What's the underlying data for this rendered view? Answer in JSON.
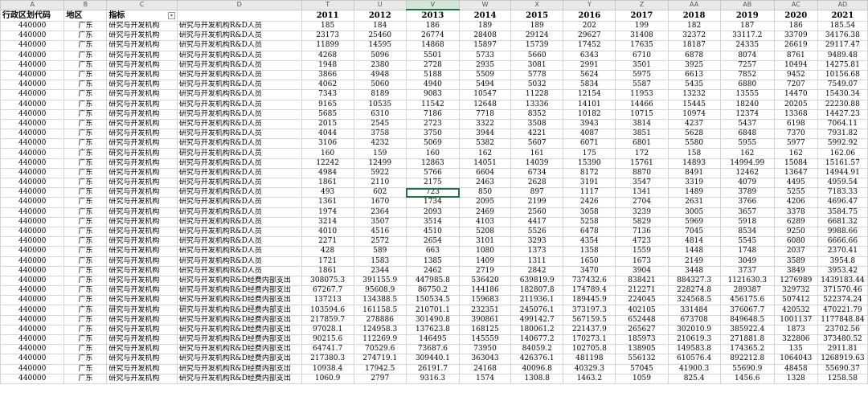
{
  "column_letters": [
    "A",
    "B",
    "C",
    "D",
    "T",
    "U",
    "V",
    "W",
    "X",
    "Y",
    "Z",
    "AA",
    "AB",
    "AC",
    "AD"
  ],
  "selected_column": "V",
  "header": [
    "行政区划代码",
    "地区",
    "指标",
    "",
    "2011",
    "2012",
    "2013",
    "2014",
    "2015",
    "2016",
    "2017",
    "2018",
    "2019",
    "2020",
    "2021"
  ],
  "code": "440000",
  "region": "广东",
  "rows": [
    [
      "研究与开发机构",
      "研究与开发机构R&D人员",
      "185",
      "184",
      "186",
      "189",
      "189",
      "202",
      "199",
      "182",
      "187",
      "186",
      "185.54"
    ],
    [
      "研究与开发机构",
      "研究与开发机构R&D人员",
      "23173",
      "25460",
      "26774",
      "28408",
      "29124",
      "29627",
      "31408",
      "32372",
      "33117.2",
      "33709",
      "34176.38"
    ],
    [
      "研究与开发机构",
      "研究与开发机构R&D人员",
      "11899",
      "14595",
      "14868",
      "15897",
      "15739",
      "17452",
      "17635",
      "18187",
      "24335",
      "26619",
      "29117.47"
    ],
    [
      "研究与开发机构",
      "研究与开发机构R&D人员",
      "4268",
      "5096",
      "5501",
      "5733",
      "5660",
      "6343",
      "6710",
      "6878",
      "8074",
      "8761",
      "9489.48"
    ],
    [
      "研究与开发机构",
      "研究与开发机构R&D人员",
      "1948",
      "2380",
      "2728",
      "2935",
      "3081",
      "2991",
      "3501",
      "3925",
      "7257",
      "10494",
      "14275.81"
    ],
    [
      "研究与开发机构",
      "研究与开发机构R&D人员",
      "3866",
      "4948",
      "5188",
      "5509",
      "5778",
      "5624",
      "5975",
      "6613",
      "7852",
      "9452",
      "10156.68"
    ],
    [
      "研究与开发机构",
      "研究与开发机构R&D人员",
      "4062",
      "5060",
      "4940",
      "5494",
      "5032",
      "5834",
      "5587",
      "5435",
      "6880",
      "7207",
      "7549.07"
    ],
    [
      "研究与开发机构",
      "研究与开发机构R&D人员",
      "7343",
      "8189",
      "9083",
      "10547",
      "11228",
      "12154",
      "11953",
      "13232",
      "13555",
      "14470",
      "15430.34"
    ],
    [
      "研究与开发机构",
      "研究与开发机构R&D人员",
      "9165",
      "10535",
      "11542",
      "12648",
      "13336",
      "14101",
      "14466",
      "15445",
      "18240",
      "20205",
      "22230.88"
    ],
    [
      "研究与开发机构",
      "研究与开发机构R&D人员",
      "5685",
      "6310",
      "7186",
      "7718",
      "8352",
      "10182",
      "10715",
      "10974",
      "12374",
      "13368",
      "14427.23"
    ],
    [
      "研究与开发机构",
      "研究与开发机构R&D人员",
      "2015",
      "2545",
      "2723",
      "3322",
      "3508",
      "3943",
      "3814",
      "4237",
      "5437",
      "6198",
      "7064.11"
    ],
    [
      "研究与开发机构",
      "研究与开发机构R&D人员",
      "4044",
      "3758",
      "3750",
      "3944",
      "4221",
      "4087",
      "3851",
      "5628",
      "6848",
      "7370",
      "7931.82"
    ],
    [
      "研究与开发机构",
      "研究与开发机构R&D人员",
      "3106",
      "4232",
      "5069",
      "5382",
      "5607",
      "6071",
      "6801",
      "5580",
      "5955",
      "5977",
      "5992.92"
    ],
    [
      "研究与开发机构",
      "研究与开发机构R&D人员",
      "160",
      "159",
      "160",
      "162",
      "161",
      "175",
      "172",
      "158",
      "162",
      "162",
      "162.06"
    ],
    [
      "研究与开发机构",
      "研究与开发机构R&D人员",
      "12242",
      "12499",
      "12863",
      "14051",
      "14039",
      "15390",
      "15761",
      "14893",
      "14994.99",
      "15084",
      "15161.57"
    ],
    [
      "研究与开发机构",
      "研究与开发机构R&D人员",
      "4984",
      "5922",
      "5766",
      "6604",
      "6734",
      "8172",
      "8870",
      "8491",
      "12462",
      "13647",
      "14944.91"
    ],
    [
      "研究与开发机构",
      "研究与开发机构R&D人员",
      "1861",
      "2110",
      "2175",
      "2463",
      "2628",
      "3191",
      "3547",
      "3319",
      "4079",
      "4495",
      "4959.54"
    ],
    [
      "研究与开发机构",
      "研究与开发机构R&D人员",
      "493",
      "602",
      "723",
      "850",
      "897",
      "1117",
      "1341",
      "1489",
      "3789",
      "5255",
      "7183.33"
    ],
    [
      "研究与开发机构",
      "研究与开发机构R&D人员",
      "1361",
      "1670",
      "1734",
      "2095",
      "2199",
      "2426",
      "2704",
      "2631",
      "3766",
      "4206",
      "4696.47"
    ],
    [
      "研究与开发机构",
      "研究与开发机构R&D人员",
      "1974",
      "2364",
      "2093",
      "2469",
      "2560",
      "3058",
      "3239",
      "3005",
      "3657",
      "3378",
      "3584.75"
    ],
    [
      "研究与开发机构",
      "研究与开发机构R&D人员",
      "3214",
      "3507",
      "3514",
      "4103",
      "4417",
      "5258",
      "5829",
      "5969",
      "5918",
      "6289",
      "6681.32"
    ],
    [
      "研究与开发机构",
      "研究与开发机构R&D人员",
      "4010",
      "4516",
      "4510",
      "5208",
      "5526",
      "6478",
      "7136",
      "7045",
      "8534",
      "9250",
      "9988.66"
    ],
    [
      "研究与开发机构",
      "研究与开发机构R&D人员",
      "2271",
      "2572",
      "2654",
      "3101",
      "3293",
      "4354",
      "4723",
      "4814",
      "5545",
      "6080",
      "6666.66"
    ],
    [
      "研究与开发机构",
      "研究与开发机构R&D人员",
      "428",
      "589",
      "663",
      "1080",
      "1373",
      "1358",
      "1559",
      "1448",
      "1748",
      "2037",
      "2370.41"
    ],
    [
      "研究与开发机构",
      "研究与开发机构R&D人员",
      "1721",
      "1583",
      "1385",
      "1409",
      "1311",
      "1650",
      "1673",
      "2149",
      "3049",
      "3589",
      "3954.8"
    ],
    [
      "研究与开发机构",
      "研究与开发机构R&D人员",
      "1861",
      "2344",
      "2462",
      "2719",
      "2842",
      "3470",
      "3904",
      "3448",
      "3737",
      "3849",
      "3953.42"
    ],
    [
      "研究与开发机构",
      "研究与开发机构R&D经费内部支出",
      "308075.3",
      "391155.9",
      "447985.8",
      "536420",
      "639819.9",
      "737432.6",
      "838421",
      "884327.3",
      "1121630.3",
      "1276989",
      "1439183.44"
    ],
    [
      "研究与开发机构",
      "研究与开发机构R&D经费内部支出",
      "67267.7",
      "95608.9",
      "86750.2",
      "144186",
      "182807.8",
      "174789.4",
      "212271",
      "228274.8",
      "289387",
      "329732",
      "371570.46"
    ],
    [
      "研究与开发机构",
      "研究与开发机构R&D经费内部支出",
      "137213",
      "134388.5",
      "150534.5",
      "159683",
      "211936.1",
      "189445.9",
      "224045",
      "324568.5",
      "456175.6",
      "507412",
      "522374.24"
    ],
    [
      "研究与开发机构",
      "研究与开发机构R&D经费内部支出",
      "103594.6",
      "161158.5",
      "210701.1",
      "232351",
      "245076.1",
      "373197.3",
      "402105",
      "331484",
      "376067.7",
      "420532",
      "470221.79"
    ],
    [
      "研究与开发机构",
      "研究与开发机构R&D经费内部支出",
      "217859.7",
      "278886",
      "301490.8",
      "390861",
      "499142.7",
      "567159.5",
      "652448",
      "673708",
      "849648.5",
      "1001137",
      "1177848.84"
    ],
    [
      "研究与开发机构",
      "研究与开发机构R&D经费内部支出",
      "97028.1",
      "124958.3",
      "137623.8",
      "168125",
      "180061.2",
      "221437.9",
      "265627",
      "302010.9",
      "385922.4",
      "1873",
      "23702.56"
    ],
    [
      "研究与开发机构",
      "研究与开发机构R&D经费内部支出",
      "90215.6",
      "112269.9",
      "146495",
      "145559",
      "140677.2",
      "170273.1",
      "185973",
      "210619.3",
      "271881.8",
      "322806",
      "373480.52"
    ],
    [
      "研究与开发机构",
      "研究与开发机构R&D经费内部支出",
      "64741.7",
      "70529.6",
      "73687.6",
      "73950",
      "84059.2",
      "102705.8",
      "138905",
      "149583.8",
      "174365.2",
      "135",
      "2911.81"
    ],
    [
      "研究与开发机构",
      "研究与开发机构R&D经费内部支出",
      "217380.3",
      "274719.1",
      "309440.1",
      "363043",
      "426376.1",
      "481198",
      "556132",
      "610576.4",
      "892212.8",
      "1064043",
      "1268919.63"
    ],
    [
      "研究与开发机构",
      "研究与开发机构R&D经费内部支出",
      "10938.4",
      "17942.5",
      "26191.7",
      "24168",
      "40096.8",
      "40329.3",
      "57045",
      "41900.3",
      "55690.9",
      "48458",
      "55690.37"
    ],
    [
      "研究与开发机构",
      "研究与开发机构R&D经费内部支出",
      "1060.9",
      "2797",
      "9316.3",
      "1574",
      "1308.8",
      "1463.2",
      "1059",
      "825.4",
      "1456.6",
      "1328",
      "1258.58"
    ]
  ]
}
